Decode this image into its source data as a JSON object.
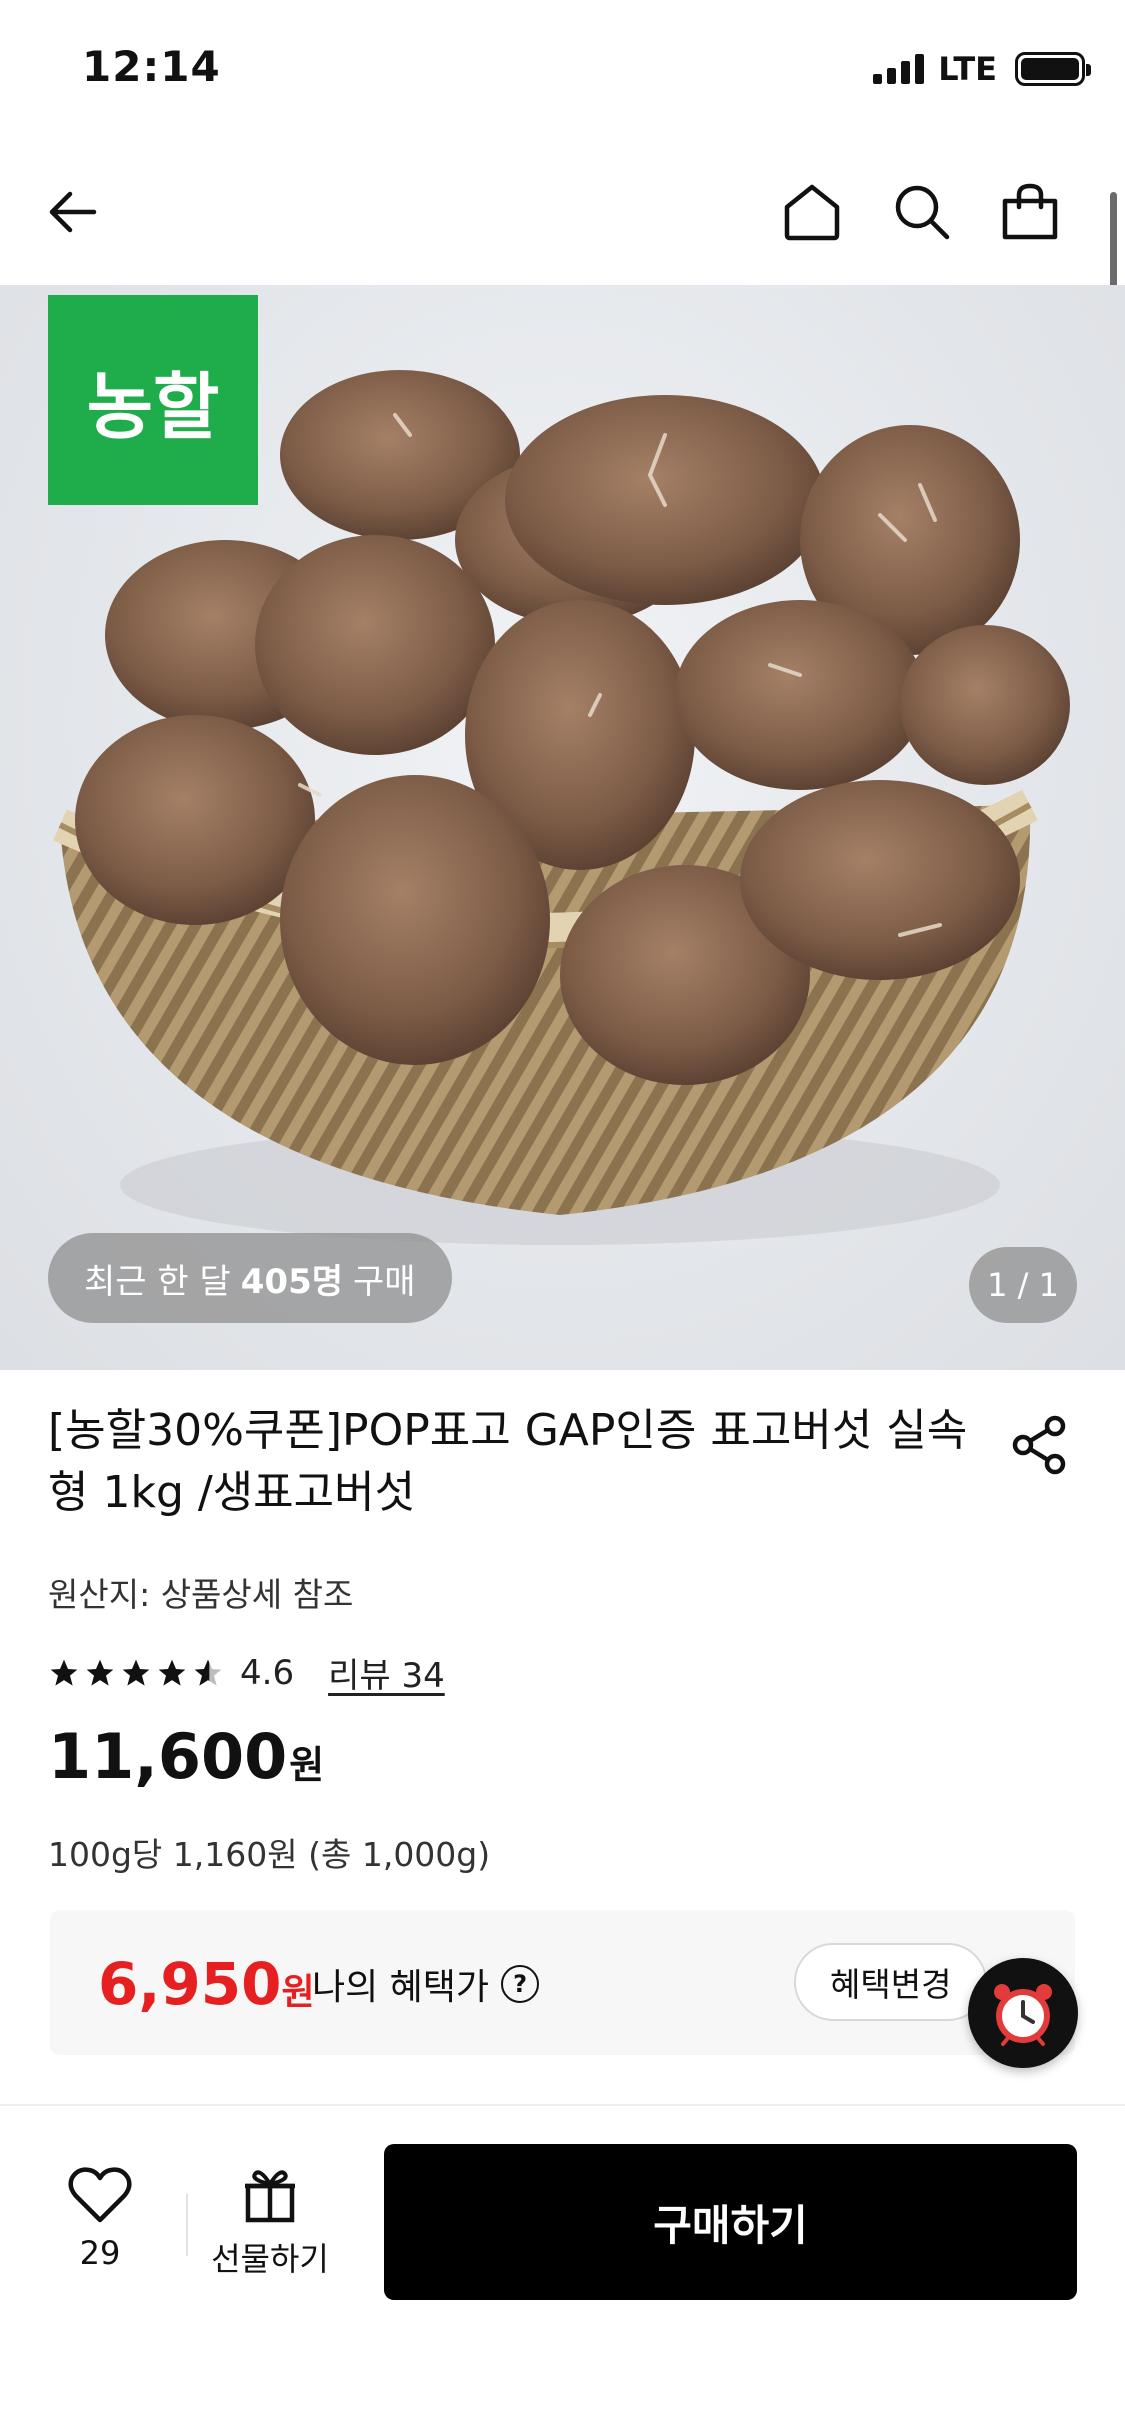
{
  "status_bar": {
    "time": "12:14",
    "network": "LTE"
  },
  "product": {
    "brand_logo_text": "농할",
    "purchase_badge": {
      "prefix": "최근 한 달 ",
      "count": "405명",
      "suffix": " 구매"
    },
    "image_indicator": "1 / 1",
    "title": "[농할30%쿠폰]POP표고 GAP인증 표고버섯 실속형 1kg /생표고버섯",
    "origin": "원산지: 상품상세 참조",
    "rating": {
      "stars": 4.6,
      "value": "4.6",
      "review_label": "리뷰 34"
    },
    "price": {
      "amount": "11,600",
      "currency": "원"
    },
    "unit_price": "100g당 1,160원 (총 1,000g)"
  },
  "benefit": {
    "price": "6,950",
    "currency": "원",
    "label": "나의 혜택가",
    "help": "?",
    "change_label": "혜택변경"
  },
  "bottom_bar": {
    "like_count": "29",
    "gift_label": "선물하기",
    "buy_label": "구매하기"
  },
  "colors": {
    "brand_green": "#1fad4b",
    "benefit_red": "#e62020",
    "buy_button": "#000000"
  }
}
